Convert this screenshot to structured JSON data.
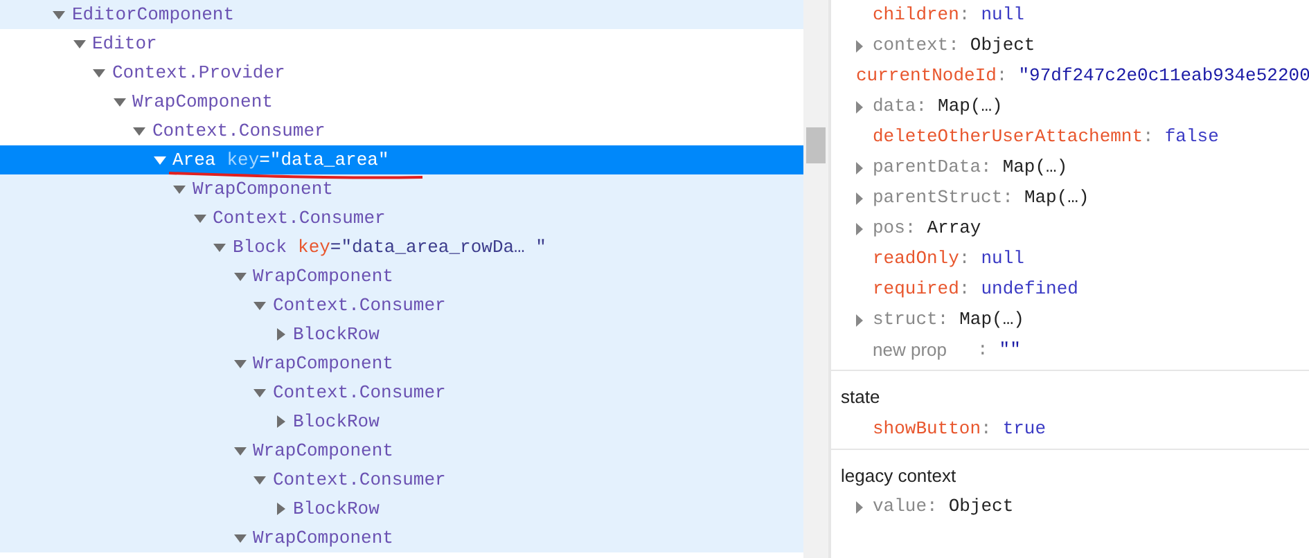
{
  "tree": [
    {
      "name": "EditorComponent",
      "expanded": true,
      "selected": false,
      "hovered": true,
      "children": [
        {
          "name": "Editor",
          "expanded": true,
          "selected": false,
          "children": [
            {
              "name": "Context.Provider",
              "expanded": true,
              "selected": false,
              "children": [
                {
                  "name": "WrapComponent",
                  "expanded": true,
                  "selected": false,
                  "children": [
                    {
                      "name": "Context.Consumer",
                      "expanded": true,
                      "selected": false,
                      "children": [
                        {
                          "name": "Area",
                          "key_name": "key",
                          "key_value": "=\"data_area\"",
                          "expanded": true,
                          "selected": true,
                          "children": [
                            {
                              "name": "WrapComponent",
                              "expanded": true,
                              "selected": false,
                              "children": [
                                {
                                  "name": "Context.Consumer",
                                  "expanded": true,
                                  "selected": false,
                                  "children": [
                                    {
                                      "name": "Block",
                                      "key_name": "key",
                                      "key_value": "=\"data_area_rowDa… \"",
                                      "expanded": true,
                                      "selected": false,
                                      "children": [
                                        {
                                          "name": "WrapComponent",
                                          "expanded": true,
                                          "selected": false,
                                          "children": [
                                            {
                                              "name": "Context.Consumer",
                                              "expanded": true,
                                              "selected": false,
                                              "children": [
                                                {
                                                  "name": "BlockRow",
                                                  "expanded": false,
                                                  "selected": false
                                                }
                                              ]
                                            }
                                          ]
                                        },
                                        {
                                          "name": "WrapComponent",
                                          "expanded": true,
                                          "selected": false,
                                          "children": [
                                            {
                                              "name": "Context.Consumer",
                                              "expanded": true,
                                              "selected": false,
                                              "children": [
                                                {
                                                  "name": "BlockRow",
                                                  "expanded": false,
                                                  "selected": false
                                                }
                                              ]
                                            }
                                          ]
                                        },
                                        {
                                          "name": "WrapComponent",
                                          "expanded": true,
                                          "selected": false,
                                          "children": [
                                            {
                                              "name": "Context.Consumer",
                                              "expanded": true,
                                              "selected": false,
                                              "children": [
                                                {
                                                  "name": "BlockRow",
                                                  "expanded": false,
                                                  "selected": false
                                                }
                                              ]
                                            }
                                          ]
                                        },
                                        {
                                          "name": "WrapComponent",
                                          "expanded": true,
                                          "selected": false
                                        }
                                      ]
                                    }
                                  ]
                                }
                              ]
                            }
                          ]
                        }
                      ]
                    }
                  ]
                }
              ]
            }
          ]
        }
      ]
    }
  ],
  "sections": [
    {
      "items": [
        {
          "kind": "plain",
          "name": "children",
          "separator": ":",
          "value": {
            "kind": "literal",
            "text": "null"
          }
        },
        {
          "kind": "expandable",
          "name": "context",
          "separator": ":",
          "value": {
            "kind": "object",
            "text": "Object"
          }
        },
        {
          "kind": "plain",
          "name": "currentNodeId",
          "separator": ":",
          "value": {
            "kind": "string",
            "text": "\"97df247c2e0c11eab934e52200"
          }
        },
        {
          "kind": "expandable",
          "name": "data",
          "separator": ":",
          "value": {
            "kind": "object",
            "text": "Map(…)"
          }
        },
        {
          "kind": "plain",
          "name": "deleteOtherUserAttachemnt",
          "separator": ":",
          "value": {
            "kind": "literal",
            "text": "false"
          }
        },
        {
          "kind": "expandable",
          "name": "parentData",
          "separator": ":",
          "value": {
            "kind": "object",
            "text": "Map(…)"
          }
        },
        {
          "kind": "expandable",
          "name": "parentStruct",
          "separator": ":",
          "value": {
            "kind": "object",
            "text": "Map(…)"
          }
        },
        {
          "kind": "expandable",
          "name": "pos",
          "separator": ":",
          "value": {
            "kind": "object",
            "text": "Array"
          }
        },
        {
          "kind": "plain",
          "name": "readOnly",
          "separator": ":",
          "value": {
            "kind": "literal",
            "text": "null"
          }
        },
        {
          "kind": "plain",
          "name": "required",
          "separator": ":",
          "value": {
            "kind": "literal",
            "text": "undefined"
          }
        },
        {
          "kind": "expandable",
          "name": "struct",
          "separator": ":",
          "value": {
            "kind": "object",
            "text": "Map(…)"
          }
        },
        {
          "kind": "new",
          "name": "new prop",
          "separator": ":",
          "value": {
            "kind": "string",
            "text": "\"\""
          }
        }
      ]
    },
    {
      "title": "state",
      "items": [
        {
          "kind": "plain",
          "name": "showButton",
          "separator": ":",
          "value": {
            "kind": "literal",
            "text": "true"
          }
        }
      ]
    },
    {
      "title": "legacy context",
      "items": [
        {
          "kind": "expandable",
          "name": "value",
          "separator": ":",
          "value": {
            "kind": "object",
            "text": "Object"
          }
        }
      ]
    }
  ]
}
